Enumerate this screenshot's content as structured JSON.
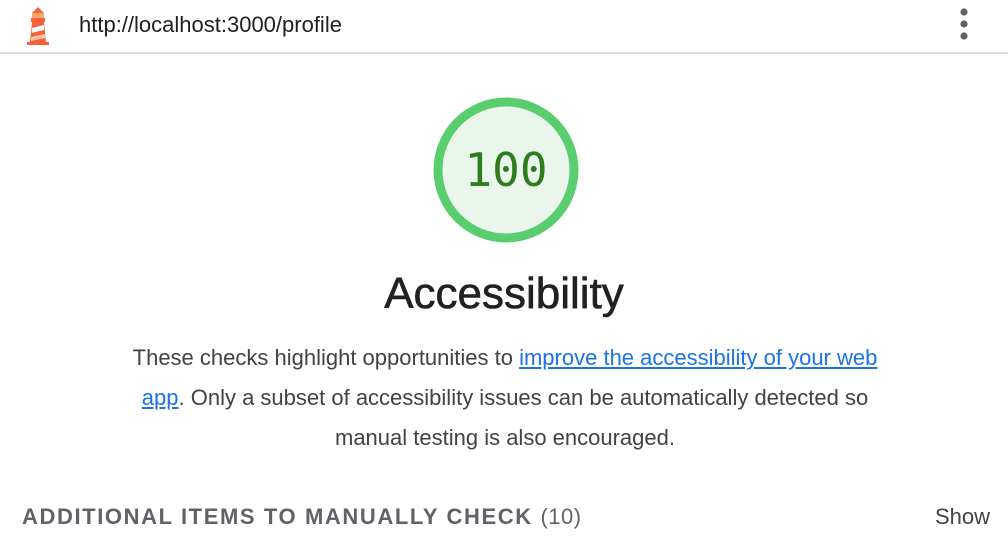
{
  "address_bar": {
    "url": "http://localhost:3000/profile",
    "logo_icon": "lighthouse-icon",
    "menu_icon": "more-vert-icon"
  },
  "score": {
    "value": 100,
    "value_text": "100",
    "fraction": 1.0,
    "ring_color": "#5ace6e",
    "fill_color": "#eaf6ec",
    "text_color": "#2d7d1c"
  },
  "category": {
    "title": "Accessibility",
    "desc_before": "These checks highlight opportunities to ",
    "desc_link": "improve the accessibility of your web app",
    "desc_after": ". Only a subset of accessibility issues can be automatically detected so manual testing is also encouraged."
  },
  "manual_section": {
    "label": "ADDITIONAL ITEMS TO MANUALLY CHECK",
    "count": "(10)",
    "toggle_label": "Show"
  },
  "colors": {
    "link": "#1a73e8",
    "pass_green": "#5ace6e",
    "logo_orange": "#f4623a"
  }
}
